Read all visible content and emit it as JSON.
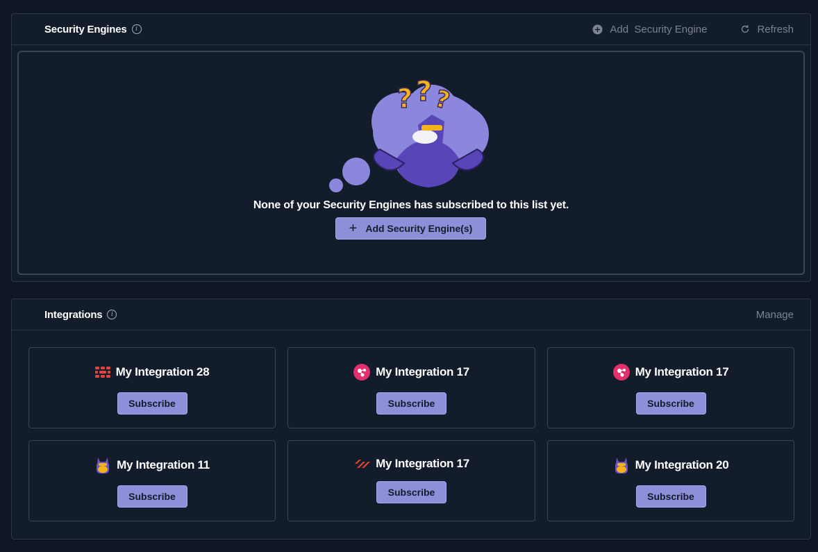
{
  "security_engines": {
    "title": "Security Engines",
    "add_label": "Add  Security Engine",
    "refresh_label": "Refresh",
    "empty_message": "None of your Security Engines has subscribed to this list yet.",
    "add_button_label": "Add Security Engine(s)"
  },
  "integrations": {
    "title": "Integrations",
    "manage_label": "Manage",
    "subscribe_label": "Subscribe",
    "cards": [
      {
        "name": "My Integration 28",
        "logo": "firewall-grid-icon"
      },
      {
        "name": "My Integration 17",
        "logo": "pink-circle-icon"
      },
      {
        "name": "My Integration 17",
        "logo": "pink-circle-icon"
      },
      {
        "name": "My Integration 11",
        "logo": "mascot-icon"
      },
      {
        "name": "My Integration 17",
        "logo": "paloalto-icon"
      },
      {
        "name": "My Integration 20",
        "logo": "mascot-icon"
      }
    ]
  },
  "colors": {
    "background": "#0f1624",
    "panel": "#131c2a",
    "accent": "#8d8fd8",
    "muted_text": "#7b8393"
  }
}
